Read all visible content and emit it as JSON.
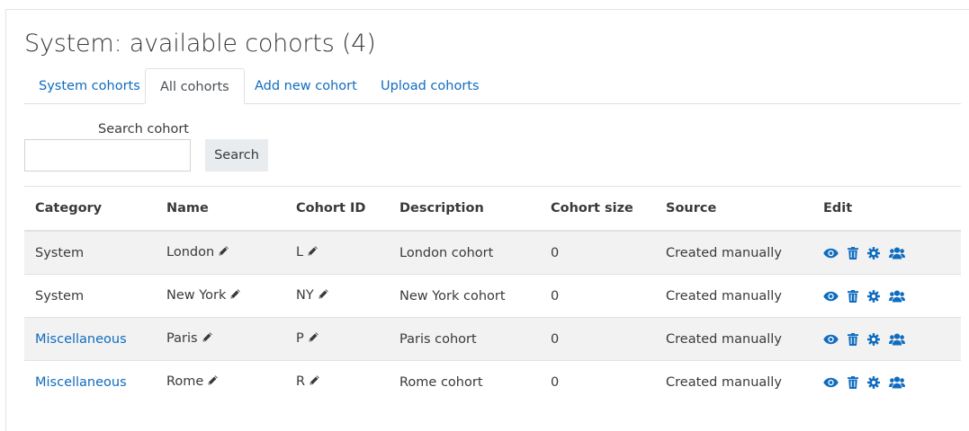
{
  "page": {
    "title": "System: available cohorts (4)"
  },
  "tabs": [
    {
      "label": "System cohorts"
    },
    {
      "label": "All cohorts"
    },
    {
      "label": "Add new cohort"
    },
    {
      "label": "Upload cohorts"
    }
  ],
  "search": {
    "label": "Search cohort",
    "value": "",
    "button_label": "Search"
  },
  "table": {
    "headers": [
      "Category",
      "Name",
      "Cohort ID",
      "Description",
      "Cohort size",
      "Source",
      "Edit"
    ],
    "rows": [
      {
        "category": "System",
        "category_link": false,
        "name": "London",
        "cohort_id": "L",
        "description": "London cohort",
        "size": "0",
        "source": "Created manually"
      },
      {
        "category": "System",
        "category_link": false,
        "name": "New York",
        "cohort_id": "NY",
        "description": "New York cohort",
        "size": "0",
        "source": "Created manually"
      },
      {
        "category": "Miscellaneous",
        "category_link": true,
        "name": "Paris",
        "cohort_id": "P",
        "description": "Paris cohort",
        "size": "0",
        "source": "Created manually"
      },
      {
        "category": "Miscellaneous",
        "category_link": true,
        "name": "Rome",
        "cohort_id": "R",
        "description": "Rome cohort",
        "size": "0",
        "source": "Created manually"
      }
    ],
    "edit_icons": [
      "eye-icon",
      "trash-icon",
      "gear-icon",
      "users-icon"
    ],
    "edit_icon_color": "#0f6cbf",
    "pencil_icon": "pencil-icon"
  },
  "colors": {
    "link": "#0f6cbf",
    "striped_row": "#f2f2f2",
    "button_bg": "#e9ecef",
    "text": "#373a3c"
  }
}
